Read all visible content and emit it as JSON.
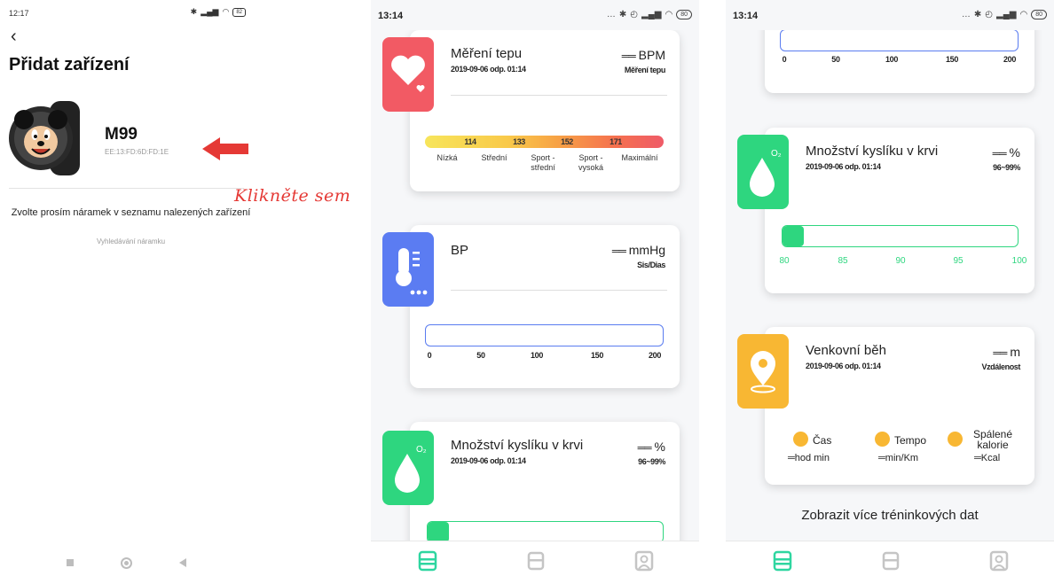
{
  "panel1": {
    "status_time": "12:17",
    "battery": "82",
    "title": "Přidat zařízení",
    "device_name": "M99",
    "device_mac": "EE:13:FD:6D:FD:1E",
    "hint": "Klikněte sem",
    "choose_text": "Zvolte prosím náramek v seznamu nalezených zařízení",
    "searching_text": "Vyhledávání náramku"
  },
  "panel2": {
    "status_time": "13:14",
    "battery": "80",
    "heart": {
      "title": "Měření tepu",
      "date": "2019-09-06 odp. 01:14",
      "unit": "BPM",
      "sub": "Měření tepu",
      "ticks": [
        "114",
        "133",
        "152",
        "171"
      ],
      "zones": [
        "Nízká",
        "Střední",
        "Sport -\nstřední",
        "Sport -\nvysoká",
        "Maximální"
      ]
    },
    "bp": {
      "title": "BP",
      "unit": "mmHg",
      "sub": "Sis/Dias",
      "axis": [
        "0",
        "50",
        "100",
        "150",
        "200"
      ]
    },
    "oxygen": {
      "title": "Množství kyslíku v krvi",
      "date": "2019-09-06 odp. 01:14",
      "unit": "%",
      "sub": "96~99%"
    }
  },
  "panel3": {
    "status_time": "13:14",
    "battery": "80",
    "bp_axis": [
      "0",
      "50",
      "100",
      "150",
      "200"
    ],
    "oxygen": {
      "title": "Množství kyslíku v krvi",
      "date": "2019-09-06 odp. 01:14",
      "unit": "%",
      "sub": "96~99%",
      "axis": [
        "80",
        "85",
        "90",
        "95",
        "100"
      ],
      "fill_fraction": 0.09
    },
    "run": {
      "title": "Venkovní běh",
      "date": "2019-09-06 odp. 01:14",
      "unit": "m",
      "sub": "Vzdálenost",
      "time_label": "Čas",
      "time_unit": "hod min",
      "pace_label": "Tempo",
      "pace_unit": "min/Km",
      "cal_label": "Spálené kalorie",
      "cal_unit": "Kcal"
    },
    "more": "Zobrazit více tréninkových dat"
  },
  "colors": {
    "heart_badge": "#f25a64",
    "bp_badge": "#5b7cf2",
    "oxygen_badge": "#2ed67f",
    "run_badge": "#f8b733",
    "accent": "#2ed6a0",
    "arrow": "#e53935"
  }
}
